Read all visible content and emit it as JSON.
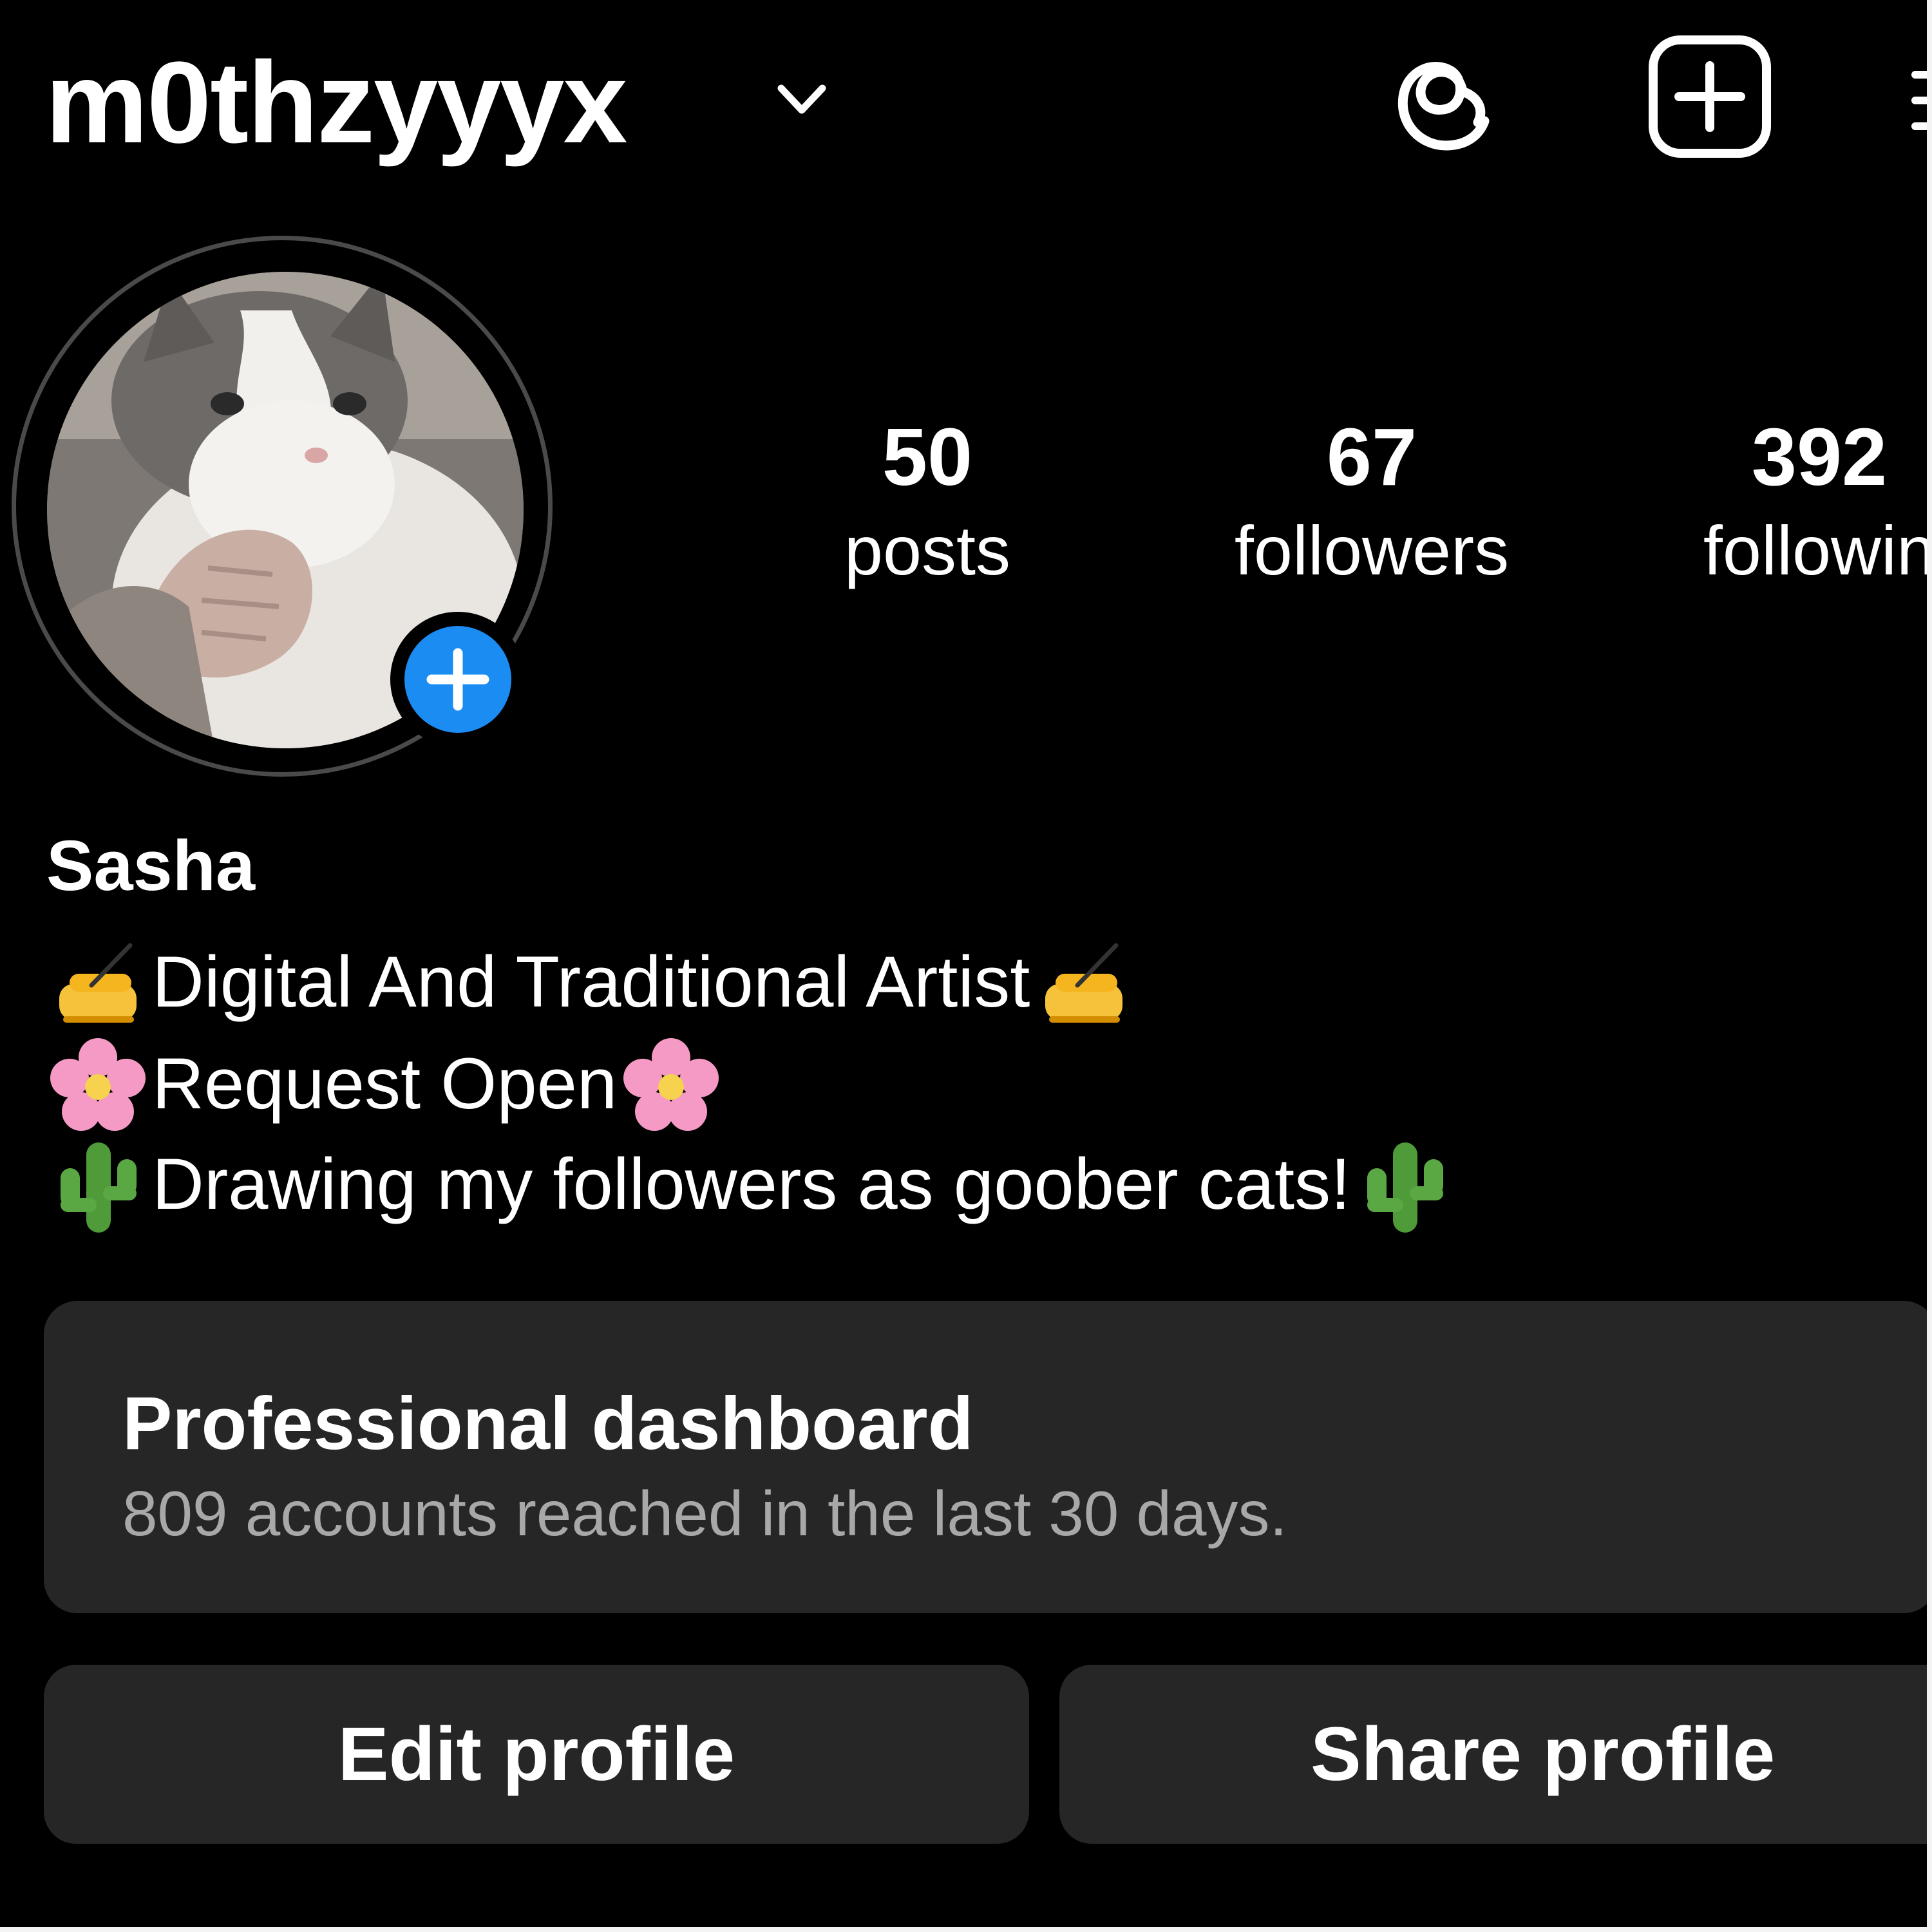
{
  "header": {
    "username": "m0thzyyyx",
    "icons": {
      "account_switcher": "chevron-down-icon",
      "threads": "threads-icon",
      "new_post": "plus-square-icon",
      "menu": "menu-icon"
    }
  },
  "profile": {
    "avatar": "cat-avatar",
    "add_story": "plus-icon",
    "display_name": "Sasha",
    "stats": {
      "posts_count": "50",
      "posts_label": "posts",
      "followers_count": "67",
      "followers_label": "followers",
      "following_count": "392",
      "following_label": "followin"
    },
    "bio": {
      "line1": "Digital And Traditional Artist",
      "line2": "Request Open",
      "line3": "Drawing my followers as goober cats!"
    }
  },
  "dashboard": {
    "title": "Professional dashboard",
    "subtitle": "809 accounts reached in the last 30 days."
  },
  "actions": {
    "edit_profile": "Edit profile",
    "share_profile": "Share profile"
  },
  "colors": {
    "background": "#000000",
    "card": "#262626",
    "accent_blue": "#1a8cf2",
    "muted_text": "#a8a8a8"
  }
}
